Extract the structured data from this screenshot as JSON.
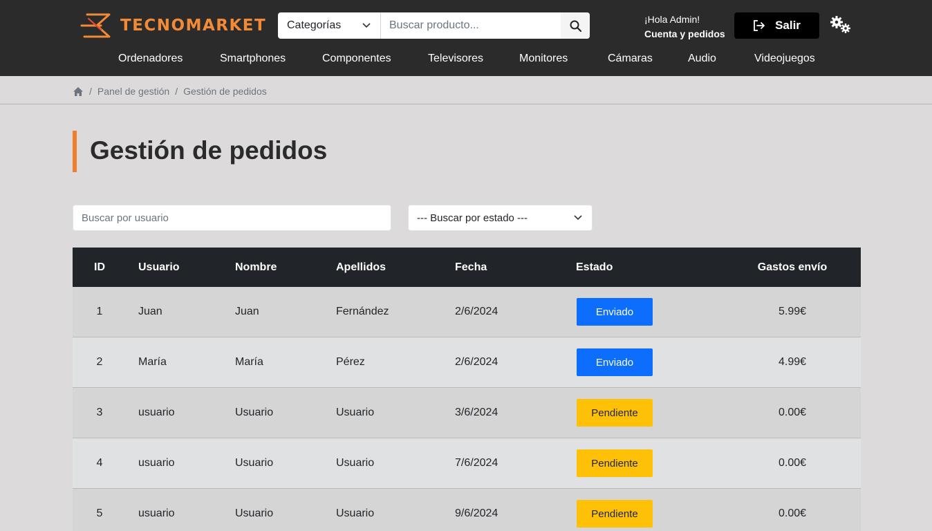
{
  "header": {
    "brand": "TECNOMARKET",
    "brand_color": "#f28a36",
    "categories_select": "Categorías",
    "search_placeholder": "Buscar producto...",
    "greeting": "¡Hola Admin!",
    "account_link": "Cuenta y pedidos",
    "logout_label": "Salir",
    "icons": [
      "search-icon",
      "logout-icon",
      "settings-icon",
      "chevron-down-icon"
    ]
  },
  "nav": {
    "items": [
      "Ordenadores",
      "Smartphones",
      "Componentes",
      "Televisores",
      "Monitores",
      "Cámaras",
      "Audio",
      "Videojuegos"
    ]
  },
  "breadcrumb": {
    "items": [
      "Panel de gestión",
      "Gestión de pedidos"
    ]
  },
  "page": {
    "title": "Gestión de pedidos",
    "accent": "#f07f2d"
  },
  "filters": {
    "user_placeholder": "Buscar por usuario",
    "state_select": "--- Buscar por estado ---"
  },
  "table": {
    "columns": [
      "ID",
      "Usuario",
      "Nombre",
      "Apellidos",
      "Fecha",
      "Estado",
      "Gastos envío"
    ],
    "rows": [
      {
        "id": "1",
        "user": "Juan",
        "name": "Juan",
        "last": "Fernández",
        "date": "2/6/2024",
        "state": "Enviado",
        "ship": "5.99€"
      },
      {
        "id": "2",
        "user": "María",
        "name": "María",
        "last": "Pérez",
        "date": "2/6/2024",
        "state": "Enviado",
        "ship": "4.99€"
      },
      {
        "id": "3",
        "user": "usuario",
        "name": "Usuario",
        "last": "Usuario",
        "date": "3/6/2024",
        "state": "Pendiente",
        "ship": "0.00€"
      },
      {
        "id": "4",
        "user": "usuario",
        "name": "Usuario",
        "last": "Usuario",
        "date": "7/6/2024",
        "state": "Pendiente",
        "ship": "0.00€"
      },
      {
        "id": "5",
        "user": "usuario",
        "name": "Usuario",
        "last": "Usuario",
        "date": "9/6/2024",
        "state": "Pendiente",
        "ship": "0.00€"
      }
    ],
    "status_colors": {
      "Enviado": "#0d6efd",
      "Pendiente": "#ffc107"
    }
  }
}
